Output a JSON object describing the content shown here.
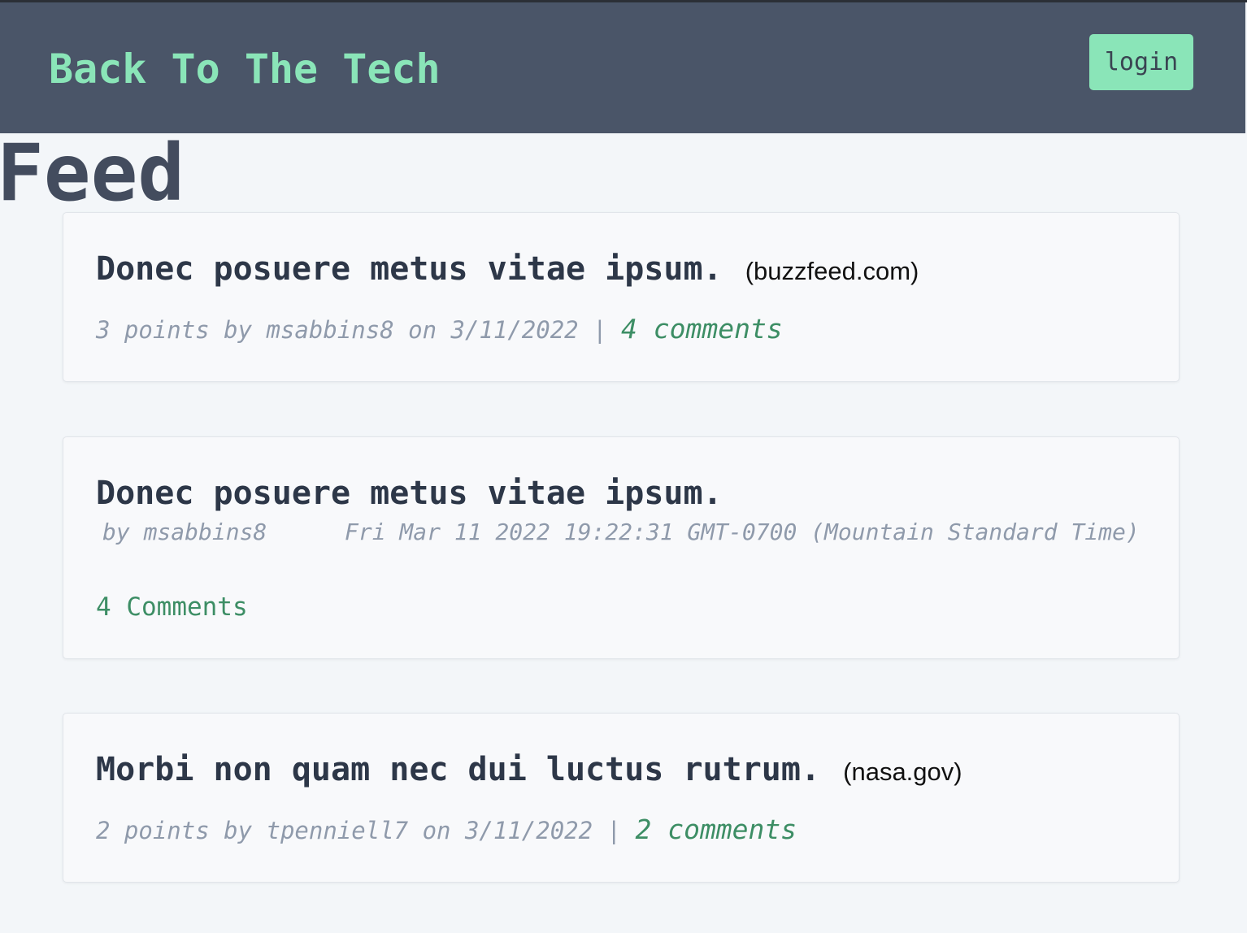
{
  "header": {
    "brand": "Back To The Tech",
    "login_label": "login"
  },
  "page": {
    "title": "Feed"
  },
  "posts": [
    {
      "title": "Donec posuere metus vitae ipsum.",
      "domain": "(buzzfeed.com)",
      "meta": "3 points by msabbins8 on 3/11/2022 | ",
      "comments": "4 comments"
    },
    {
      "title": "Donec posuere metus vitae ipsum.",
      "byline": "by msabbins8",
      "date": "Fri Mar 11 2022 19:22:31 GMT-0700 (Mountain Standard Time)",
      "comments": "4 Comments"
    },
    {
      "title": "Morbi non quam nec dui luctus rutrum.",
      "domain": "(nasa.gov)",
      "meta": "2 points by tpenniell7 on 3/11/2022 | ",
      "comments": "2 comments"
    }
  ],
  "colors": {
    "header_bg": "#4a5568",
    "accent": "#8ae5b8",
    "link": "#3d8e65",
    "page_bg": "#f3f6f9"
  }
}
